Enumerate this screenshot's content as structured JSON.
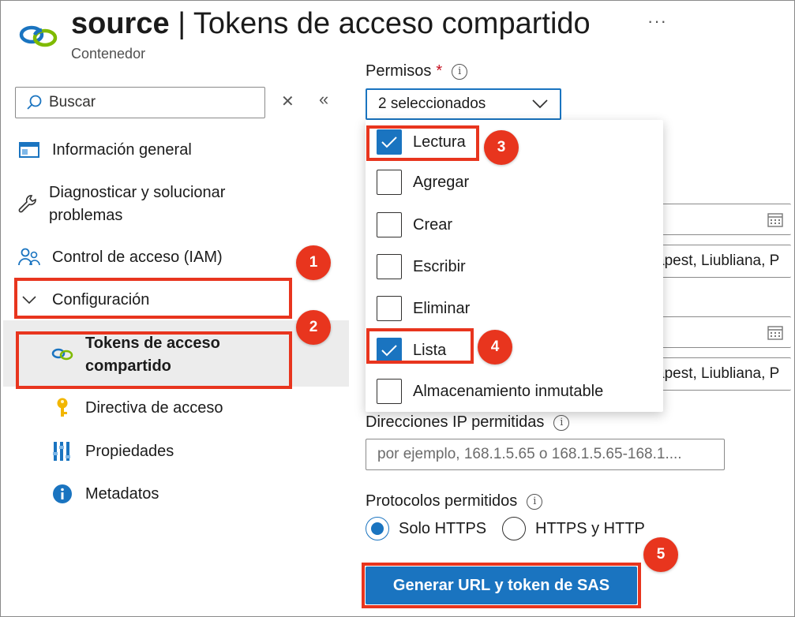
{
  "header": {
    "title_name": "source",
    "title_rest": "| Tokens de acceso compartido",
    "subtitle": "Contenedor",
    "more_label": "···"
  },
  "sidebar": {
    "search_placeholder": "Buscar",
    "clear_label": "✕",
    "collapse_label": "«",
    "items": [
      {
        "label": "Información general",
        "icon": "overview-icon"
      },
      {
        "label": "Diagnosticar y solucionar problemas",
        "icon": "wrench-icon"
      },
      {
        "label": "Control de acceso (IAM)",
        "icon": "people-icon"
      },
      {
        "label": "Configuración",
        "icon": "chevron-down-icon"
      }
    ],
    "sub_items": [
      {
        "label": "Tokens de acceso compartido",
        "icon": "link-icon",
        "selected": true
      },
      {
        "label": "Directiva de acceso",
        "icon": "key-icon"
      },
      {
        "label": "Propiedades",
        "icon": "properties-icon"
      },
      {
        "label": "Metadatos",
        "icon": "info-icon"
      }
    ]
  },
  "form": {
    "permisos_label": "Permisos",
    "required_mark": "*",
    "permisos_value": "2 seleccionados",
    "permission_options": [
      {
        "label": "Lectura",
        "checked": true
      },
      {
        "label": "Agregar",
        "checked": false
      },
      {
        "label": "Crear",
        "checked": false
      },
      {
        "label": "Escribir",
        "checked": false
      },
      {
        "label": "Eliminar",
        "checked": false
      },
      {
        "label": "Lista",
        "checked": true
      },
      {
        "label": "Almacenamiento inmutable",
        "checked": false
      }
    ],
    "start_timezone_partial": "apest, Liubliana, P",
    "expiry_timezone_partial": "apest, Liubliana, P",
    "ip_label": "Direcciones IP permitidas",
    "ip_placeholder": "por ejemplo, 168.1.5.65 o 168.1.5.65-168.1....",
    "protocols_label": "Protocolos permitidos",
    "protocol_options": [
      {
        "label": "Solo HTTPS",
        "selected": true
      },
      {
        "label": "HTTPS y HTTP",
        "selected": false
      }
    ],
    "generate_button": "Generar URL y token de SAS"
  },
  "annotations": [
    "1",
    "2",
    "3",
    "4",
    "5"
  ],
  "colors": {
    "accent": "#1a74c0",
    "annotation_red": "#e8351e",
    "selected_bg": "#ececec"
  }
}
